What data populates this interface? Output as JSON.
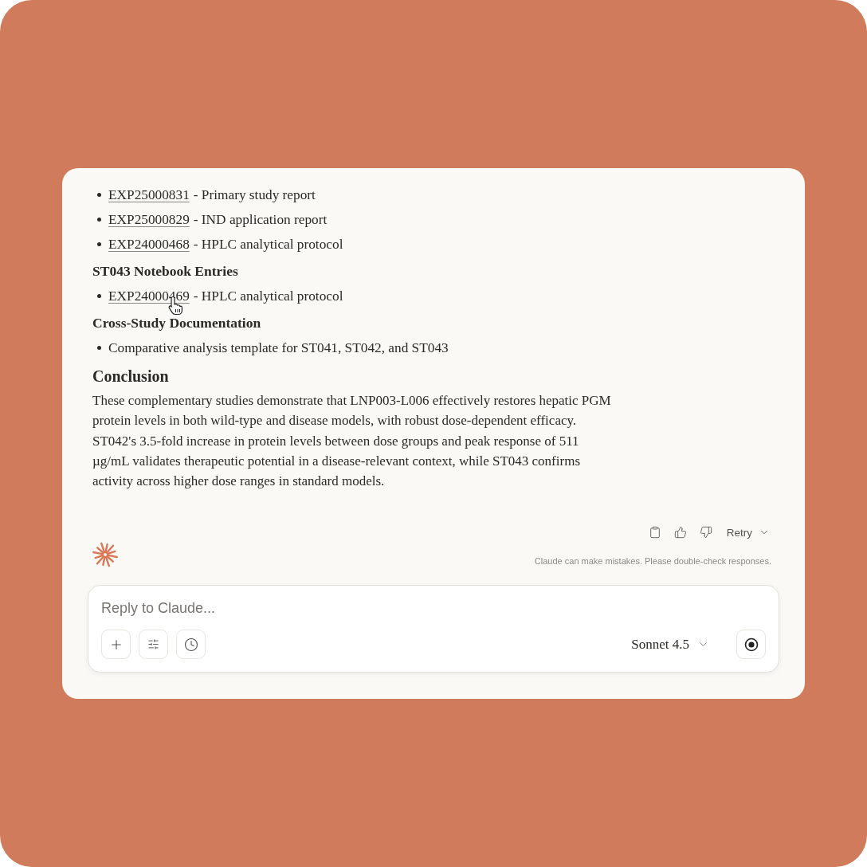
{
  "message": {
    "blocks": [
      {
        "kind": "list",
        "items": [
          {
            "link": "EXP25000831",
            "text": "- Primary study report",
            "pointer": false
          },
          {
            "link": "EXP25000829",
            "text": "- IND application report",
            "pointer": false
          },
          {
            "link": "EXP24000468",
            "text": "- HPLC analytical protocol",
            "pointer": false
          }
        ]
      },
      {
        "kind": "subheading",
        "text": "ST043 Notebook Entries"
      },
      {
        "kind": "list",
        "items": [
          {
            "link": "EXP24000469",
            "text": "- HPLC analytical protocol",
            "pointer": true
          }
        ]
      },
      {
        "kind": "subheading",
        "text": "Cross-Study Documentation"
      },
      {
        "kind": "list",
        "items": [
          {
            "text": "Comparative analysis template for ST041, ST042, and ST043",
            "pointer": false
          }
        ]
      },
      {
        "kind": "heading",
        "text": "Conclusion"
      },
      {
        "kind": "paragraph",
        "text": "These complementary studies demonstrate that LNP003-L006 effectively restores hepatic PGM protein levels in both wild-type and disease models, with robust dose-dependent efficacy. ST042's 3.5-fold increase in protein levels between dose groups and peak response of 511 µg/mL validates therapeutic potential in a disease-relevant context, while ST043 confirms activity across higher dose ranges in standard models."
      }
    ]
  },
  "actions": {
    "retry": "Retry"
  },
  "disclaimer": "Claude can make mistakes. Please double-check responses.",
  "composer": {
    "placeholder": "Reply to Claude...",
    "model": "Sonnet 4.5"
  }
}
